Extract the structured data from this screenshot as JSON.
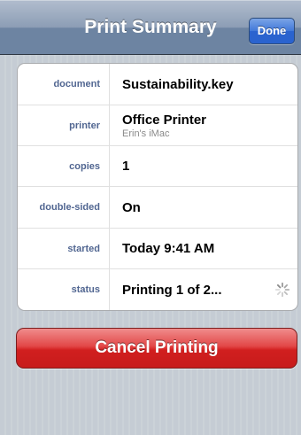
{
  "navbar": {
    "title": "Print Summary",
    "done_label": "Done"
  },
  "summary": {
    "rows": [
      {
        "label": "document",
        "value": "Sustainability.key",
        "sub": ""
      },
      {
        "label": "printer",
        "value": "Office Printer",
        "sub": "Erin's iMac"
      },
      {
        "label": "copies",
        "value": "1",
        "sub": ""
      },
      {
        "label": "double-sided",
        "value": "On",
        "sub": ""
      },
      {
        "label": "started",
        "value": "Today 9:41 AM",
        "sub": ""
      },
      {
        "label": "status",
        "value": "Printing 1 of 2...",
        "sub": ""
      }
    ]
  },
  "actions": {
    "cancel_label": "Cancel Printing"
  },
  "colors": {
    "label_blue": "#516691",
    "cancel_red": "#d11f1f",
    "done_blue": "#2a63cf"
  },
  "icons": {
    "status_spinner": "activity-spinner-icon"
  }
}
